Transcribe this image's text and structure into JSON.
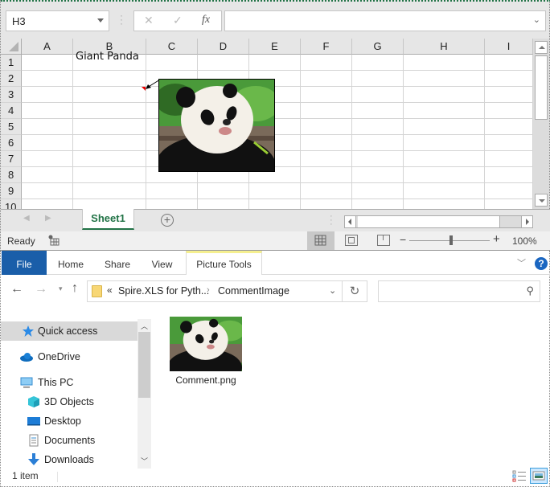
{
  "excel": {
    "name_box": "H3",
    "formula_bar_value": "",
    "formula_buttons": {
      "cancel": "✕",
      "enter": "✓",
      "fx": "fx"
    },
    "columns": [
      "A",
      "B",
      "C",
      "D",
      "E",
      "F",
      "G",
      "H",
      "I"
    ],
    "rows": [
      "1",
      "2",
      "3",
      "4",
      "5",
      "6",
      "7",
      "8",
      "9",
      "10"
    ],
    "cells": {
      "B3": "Giant Panda"
    },
    "comment_image": "panda-picture",
    "sheet_tabs": [
      {
        "label": "Sheet1",
        "active": true
      }
    ],
    "status": "Ready",
    "zoom": "100%",
    "zoom_minus": "−",
    "zoom_plus": "+",
    "accent_color": "#217346"
  },
  "explorer": {
    "ribbon_tabs": [
      "File",
      "Home",
      "Share",
      "View",
      "Picture Tools"
    ],
    "address": {
      "overflow": "«",
      "part1": "Spire.XLS for Pyth...",
      "sep": "›",
      "part2": "CommentImage"
    },
    "search_placeholder": "",
    "nav": [
      {
        "label": "Quick access",
        "icon": "star-icon",
        "selected": true
      },
      {
        "label": "OneDrive",
        "icon": "cloud-icon"
      },
      {
        "label": "This PC",
        "icon": "computer-icon"
      },
      {
        "label": "3D Objects",
        "icon": "cube-icon"
      },
      {
        "label": "Desktop",
        "icon": "desktop-icon"
      },
      {
        "label": "Documents",
        "icon": "document-icon"
      },
      {
        "label": "Downloads",
        "icon": "download-icon"
      }
    ],
    "files": [
      {
        "name": "Comment.png",
        "type": "image"
      }
    ],
    "status": "1 item",
    "accent_color": "#1a5ea9"
  }
}
